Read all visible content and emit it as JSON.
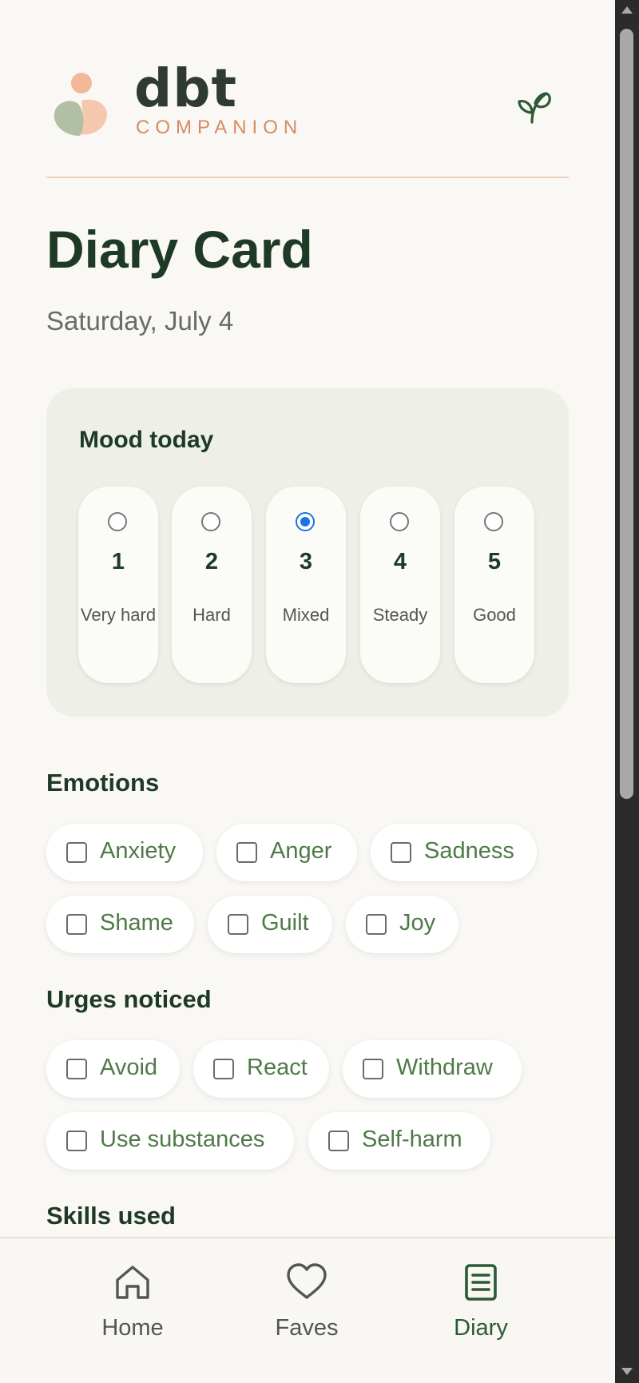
{
  "brand": {
    "name": "dbt",
    "subtitle": "COMPANION"
  },
  "header": {
    "action_icon": "sprout-icon"
  },
  "page": {
    "title": "Diary Card",
    "date": "Saturday, July 4"
  },
  "mood": {
    "title": "Mood today",
    "selected": 3,
    "options": [
      {
        "value": "1",
        "label": "Very hard"
      },
      {
        "value": "2",
        "label": "Hard"
      },
      {
        "value": "3",
        "label": "Mixed"
      },
      {
        "value": "4",
        "label": "Steady"
      },
      {
        "value": "5",
        "label": "Good"
      }
    ]
  },
  "emotions": {
    "title": "Emotions",
    "items": [
      "Anxiety",
      "Anger",
      "Sadness",
      "Shame",
      "Guilt",
      "Joy"
    ]
  },
  "urges": {
    "title": "Urges noticed",
    "items": [
      "Avoid",
      "React",
      "Withdraw",
      "Use substances",
      "Self-harm"
    ]
  },
  "skills": {
    "title": "Skills used"
  },
  "nav": {
    "items": [
      {
        "label": "Home",
        "icon": "home-icon"
      },
      {
        "label": "Faves",
        "icon": "heart-icon"
      },
      {
        "label": "Diary",
        "icon": "diary-icon"
      }
    ],
    "active": "Diary"
  },
  "colors": {
    "accent": "#2d5a33",
    "brand_sub": "#d98a62",
    "chip_text": "#4f7a48",
    "radio_selected": "#1a73e8"
  }
}
